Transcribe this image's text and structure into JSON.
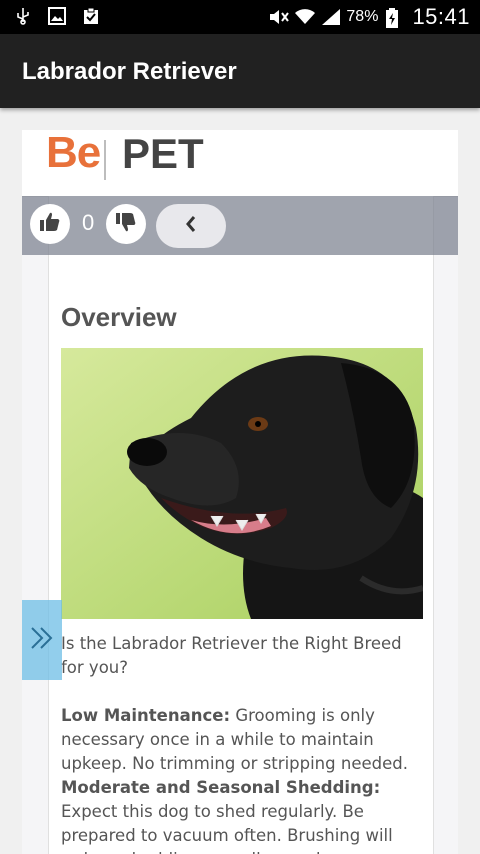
{
  "status_bar": {
    "battery": "78%",
    "time": "15:41",
    "icons": [
      "usb-icon",
      "image-icon",
      "clipboard-check-icon",
      "mute-icon",
      "wifi-icon",
      "signal-icon",
      "battery-charging-icon"
    ]
  },
  "app_bar": {
    "title": "Labrador Retriever"
  },
  "logo": {
    "be": "Be",
    "pet": "PET",
    "be_color": "#e8713a"
  },
  "votes": {
    "count": "0"
  },
  "article": {
    "heading": "Overview",
    "intro": "Is the Labrador Retriever the Right Breed for you?",
    "sections": [
      {
        "title": "Low Maintenance:",
        "body": "Grooming is only necessary once in a while to maintain upkeep. No trimming or stripping needed."
      },
      {
        "title": "Moderate and Seasonal Shedding:",
        "body": "Expect this dog to shed regularly. Be prepared to vacuum often. Brushing will reduce shedding as well as make"
      }
    ]
  },
  "colors": {
    "app_bar": "#212121",
    "accent_handle": "#6ebee6"
  }
}
